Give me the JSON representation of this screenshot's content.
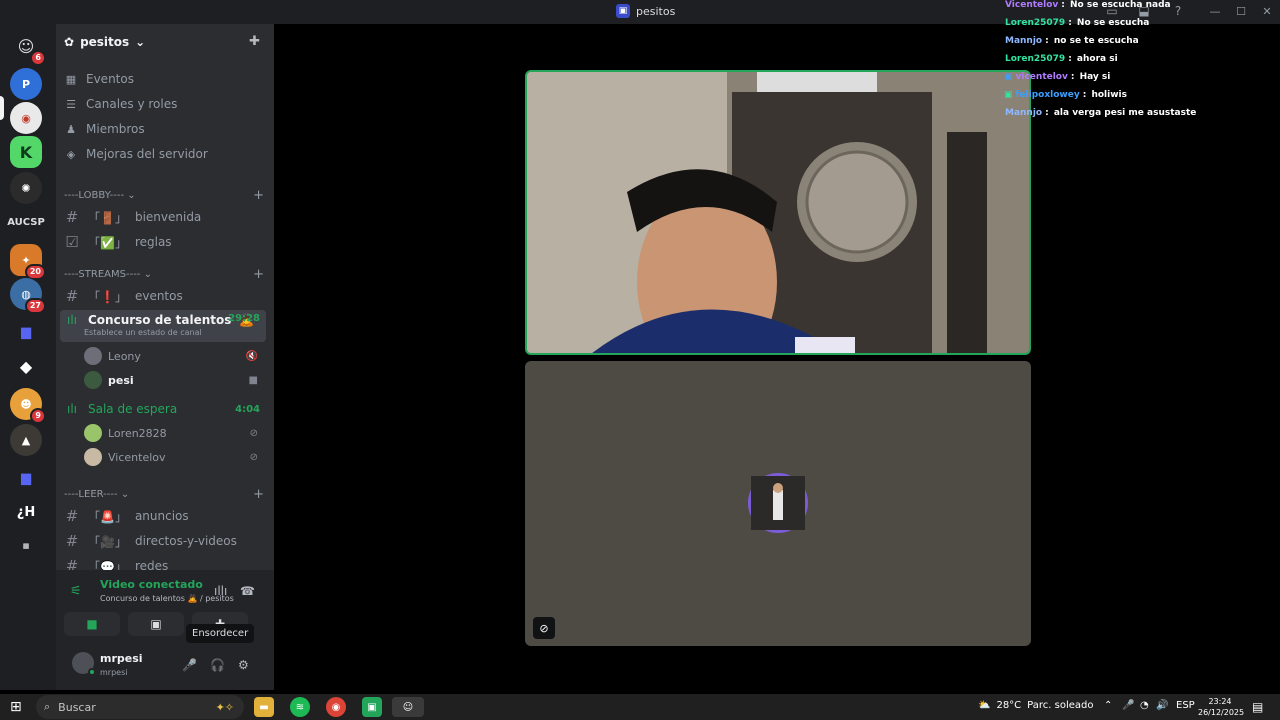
{
  "window": {
    "title": "pesitos"
  },
  "rail": {
    "servers": [
      {
        "name": "home",
        "badge": "6"
      },
      {
        "name": "server-2",
        "badge": ""
      },
      {
        "name": "server-3",
        "badge": ""
      },
      {
        "name": "server-k",
        "badge": ""
      },
      {
        "name": "server-5",
        "badge": ""
      },
      {
        "name": "server-aucsp",
        "text": "AUCSP"
      },
      {
        "name": "server-7",
        "badge": "20"
      },
      {
        "name": "server-8",
        "badge": "27"
      },
      {
        "name": "folder-1",
        "badge": ""
      },
      {
        "name": "server-10",
        "badge": ""
      },
      {
        "name": "server-11",
        "badge": "9"
      },
      {
        "name": "server-12",
        "badge": ""
      },
      {
        "name": "folder-2",
        "badge": ""
      },
      {
        "name": "server-h",
        "text": "¿H"
      },
      {
        "name": "server-15",
        "badge": ""
      }
    ]
  },
  "sidebar": {
    "guild_name": "pesitos",
    "menu": [
      {
        "label": "Eventos",
        "icon": "calendar-icon"
      },
      {
        "label": "Canales y roles",
        "icon": "list-icon"
      },
      {
        "label": "Miembros",
        "icon": "members-icon"
      },
      {
        "label": "Mejoras del servidor",
        "icon": "boost-icon"
      }
    ],
    "categories": {
      "lobby": "----LOBBY----",
      "streams": "----STREAMS----",
      "leer": "----LEER----"
    },
    "channels": {
      "bienvenida": "bienvenida",
      "reglas": "reglas",
      "eventos": "eventos",
      "talentos": "Concurso de talentos",
      "talentos_timer": "29:28",
      "talentos_status": "Establece un estado de canal",
      "espera": "Sala de espera",
      "espera_timer": "4:04",
      "anuncios": "anuncios",
      "directos": "directos-y-videos",
      "redes": "redes"
    },
    "voice_users_talentos": [
      "Leony",
      "pesi"
    ],
    "voice_users_espera": [
      "Loren2828",
      "Vicentelov"
    ]
  },
  "voice_panel": {
    "status": "Video conectado",
    "subtitle": "Concurso de talentos 🙇 / pesitos",
    "tooltip": "Ensordecer"
  },
  "user": {
    "name": "mrpesi",
    "tag": "mrpesi"
  },
  "chat": [
    {
      "user": "Vicentelov",
      "msg": "No se escucha nada",
      "color": "#b07cff"
    },
    {
      "user": "Loren25079",
      "msg": "No se escucha",
      "color": "#33e3a0"
    },
    {
      "user": "Mannjo",
      "msg": "no se te escucha",
      "color": "#8fb8ff"
    },
    {
      "user": "Loren25079",
      "msg": "ahora si",
      "color": "#33e3a0"
    },
    {
      "user": "vicentelov",
      "msg": "Hay si",
      "color": "#b07cff"
    },
    {
      "user": "felipoxlowey",
      "msg": "holiwis",
      "color": "#3aa0ff"
    },
    {
      "user": "Mannjo",
      "msg": "ala verga pesi me asustaste",
      "color": "#8fb8ff"
    }
  ],
  "taskbar": {
    "search_placeholder": "Buscar",
    "weather": "28°C",
    "weather_desc": "Parc. soleado",
    "lang": "ESP",
    "time": "23:24",
    "date": "26/12/2025"
  },
  "colors": {
    "accent_green": "#23a55a",
    "sidebar": "#2b2d31",
    "rail": "#1e1f22"
  }
}
